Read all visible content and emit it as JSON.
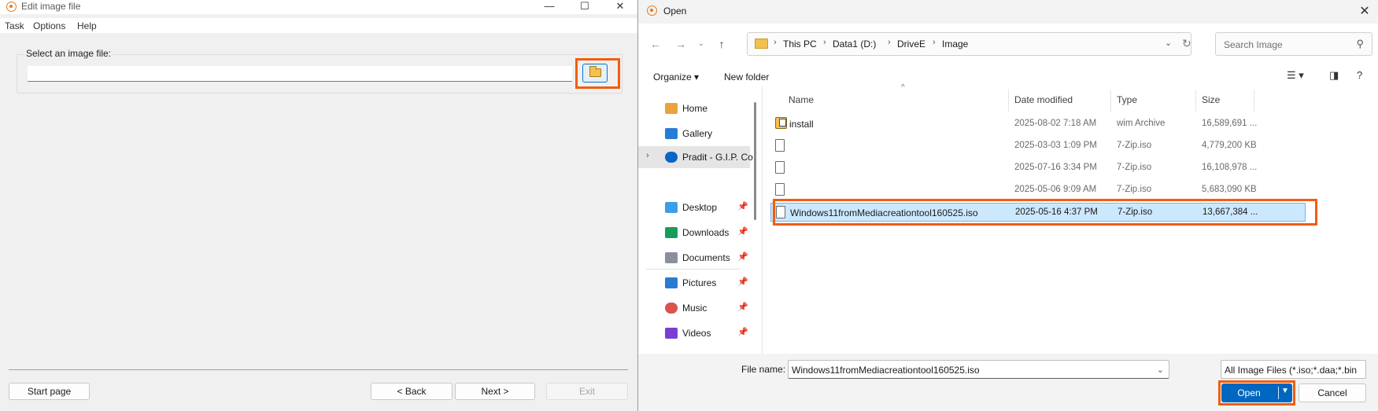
{
  "app": {
    "title": "Edit image file",
    "window_controls": {
      "minimize": "—",
      "maximize": "☐",
      "close": "✕"
    },
    "menu": [
      "Task",
      "Options",
      "Help"
    ],
    "group_label": "Select an image file:",
    "path_value": "",
    "buttons": {
      "start_page": "Start page",
      "back": "< Back",
      "next": "Next >",
      "exit": "Exit"
    }
  },
  "dialog": {
    "title": "Open",
    "close": "✕",
    "address": [
      "This PC",
      "Data1 (D:)",
      "DriveE",
      "Image"
    ],
    "search_placeholder": "Search Image",
    "toolbar": {
      "organize": "Organize ▾",
      "new_folder": "New folder"
    },
    "nav": [
      {
        "label": "Home",
        "icon": "home-icon",
        "color": "#e8a33c"
      },
      {
        "label": "Gallery",
        "icon": "gallery-icon",
        "color": "#2a7bd4"
      },
      {
        "label": "Pradit - G.I.P. Co",
        "icon": "onedrive-icon",
        "color": "#0a64c8"
      },
      {
        "label": "Desktop",
        "icon": "desktop-icon",
        "color": "#3aa0e6"
      },
      {
        "label": "Downloads",
        "icon": "downloads-icon",
        "color": "#1a9b5c"
      },
      {
        "label": "Documents",
        "icon": "documents-icon",
        "color": "#8a8fa0"
      },
      {
        "label": "Pictures",
        "icon": "pictures-icon",
        "color": "#2a7bd4"
      },
      {
        "label": "Music",
        "icon": "music-icon",
        "color": "#d9534f"
      },
      {
        "label": "Videos",
        "icon": "videos-icon",
        "color": "#7a3fd1"
      }
    ],
    "columns": {
      "name": "Name",
      "date": "Date modified",
      "type": "Type",
      "size": "Size"
    },
    "files": [
      {
        "name": "install",
        "date": "2025-08-02 7:18 AM",
        "type": "wim Archive",
        "size": "16,589,691 ..."
      },
      {
        "name": "",
        "date": "2025-03-03 1:09 PM",
        "type": "7-Zip.iso",
        "size": "4,779,200 KB"
      },
      {
        "name": "",
        "date": "2025-07-16 3:34 PM",
        "type": "7-Zip.iso",
        "size": "16,108,978 ..."
      },
      {
        "name": "",
        "date": "2025-05-06 9:09 AM",
        "type": "7-Zip.iso",
        "size": "5,683,090 KB"
      },
      {
        "name": "Windows11fromMediacreationtool160525.iso",
        "date": "2025-05-16 4:37 PM",
        "type": "7-Zip.iso",
        "size": "13,667,384 ..."
      }
    ],
    "footer": {
      "file_name_label": "File name:",
      "file_name_value": "Windows11fromMediacreationtool160525.iso",
      "filter": "All Image Files (*.iso;*.daa;*.bin",
      "open": "Open",
      "cancel": "Cancel"
    }
  },
  "colors": {
    "highlight": "#f25d0e",
    "accent": "#0067c0",
    "selection": "#cce8ff"
  }
}
